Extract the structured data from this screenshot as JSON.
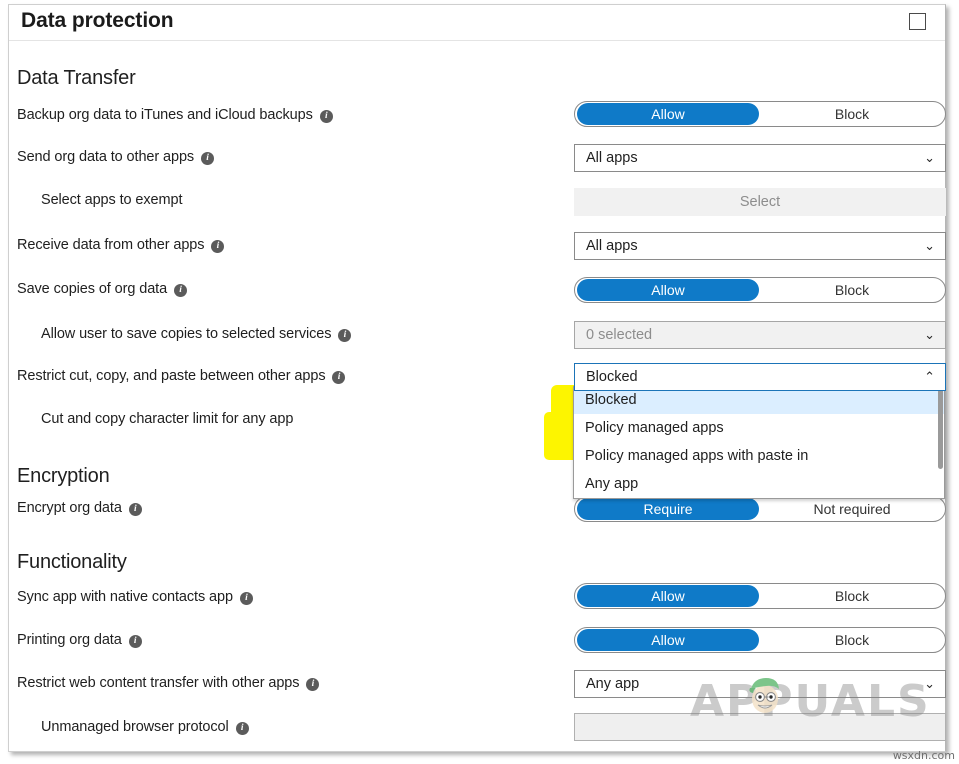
{
  "window": {
    "title": "Data protection",
    "maximize_icon": "square-outline-icon"
  },
  "sections": [
    {
      "id": "data_transfer",
      "title": "Data Transfer"
    },
    {
      "id": "encryption",
      "title": "Encryption"
    },
    {
      "id": "functionality",
      "title": "Functionality"
    }
  ],
  "rows": {
    "backup_org_data": {
      "label": "Backup org data to iTunes and iCloud backups",
      "control": "toggle",
      "on_label": "Allow",
      "off_label": "Block",
      "selected": "Allow"
    },
    "send_org_data": {
      "label": "Send org data to other apps",
      "control": "dropdown",
      "value": "All apps"
    },
    "select_apps_exempt": {
      "label": "Select apps to exempt",
      "control": "button",
      "button_label": "Select",
      "disabled": true
    },
    "receive_data": {
      "label": "Receive data from other apps",
      "control": "dropdown",
      "value": "All apps"
    },
    "save_copies": {
      "label": "Save copies of org data",
      "control": "toggle",
      "on_label": "Allow",
      "off_label": "Block",
      "selected": "Allow"
    },
    "allow_user_save": {
      "label": "Allow user to save copies to selected services",
      "control": "dropdown",
      "value": "0 selected",
      "disabled": true
    },
    "restrict_ccp": {
      "label": "Restrict cut, copy, and paste between other apps",
      "control": "dropdown",
      "value": "Blocked",
      "expanded": true,
      "options": [
        "Blocked",
        "Policy managed apps",
        "Policy managed apps with paste in",
        "Any app"
      ],
      "selected_option": "Blocked"
    },
    "char_limit": {
      "label": "Cut and copy character limit for any app",
      "control": "none"
    },
    "encrypt_org_data": {
      "label": "Encrypt org data",
      "control": "toggle",
      "on_label": "Require",
      "off_label": "Not required",
      "selected": "Require"
    },
    "sync_contacts": {
      "label": "Sync app with native contacts app",
      "control": "toggle",
      "on_label": "Allow",
      "off_label": "Block",
      "selected": "Allow"
    },
    "printing_org_data": {
      "label": "Printing org data",
      "control": "toggle",
      "on_label": "Allow",
      "off_label": "Block",
      "selected": "Allow"
    },
    "restrict_web_content": {
      "label": "Restrict web content transfer with other apps",
      "control": "dropdown",
      "value": "Any app"
    },
    "unmanaged_browser": {
      "label": "Unmanaged browser protocol",
      "control": "textinput",
      "value": "",
      "disabled": true
    }
  },
  "icons": {
    "info": "i",
    "chevron_down": "⌄",
    "chevron_up": "⌃"
  },
  "colors": {
    "accent_blue": "#0f7ac8",
    "highlight_yellow": "#fdf500",
    "option_selected_blue": "#dbeeff"
  },
  "watermark": {
    "brand": "APPUALS",
    "credit": "wsxdn.com"
  }
}
